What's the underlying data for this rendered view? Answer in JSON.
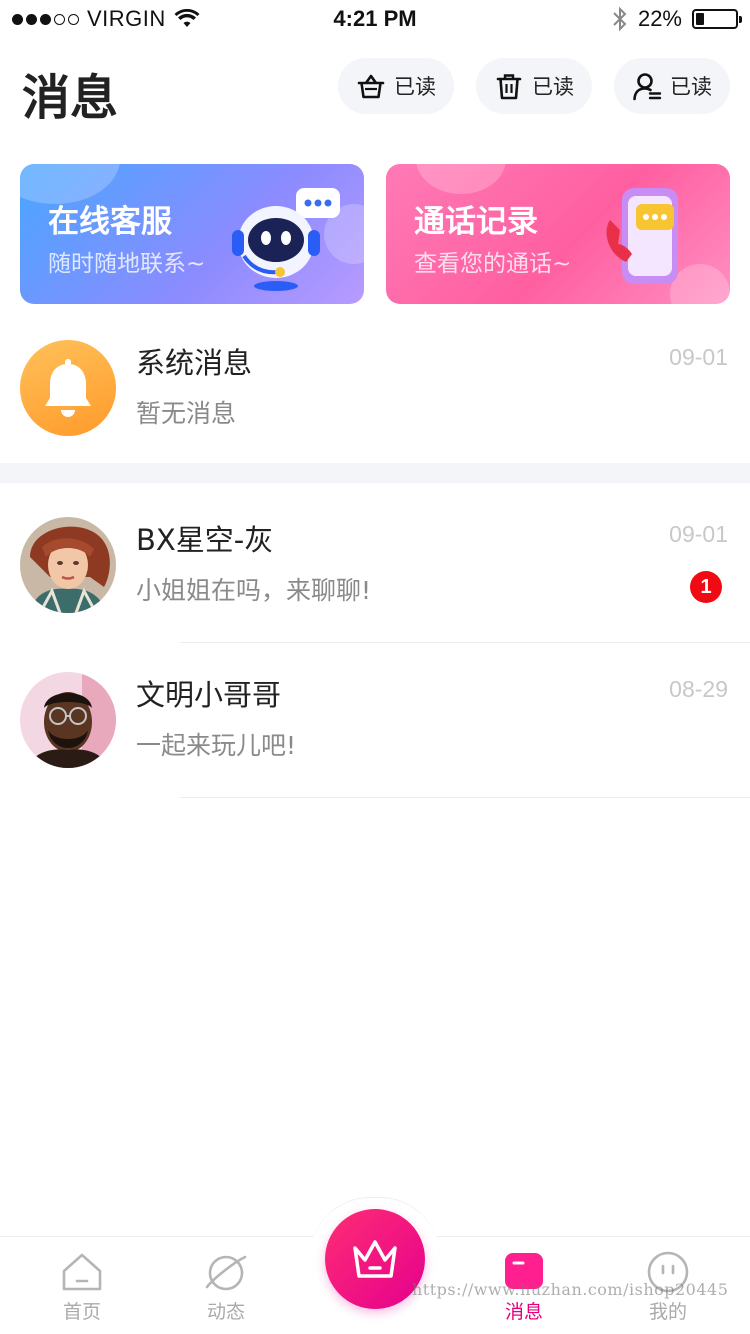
{
  "status_bar": {
    "carrier": "VIRGIN",
    "time": "4:21 PM",
    "battery": "22%",
    "battery_level": 0.22
  },
  "header": {
    "title": "消息",
    "actions": [
      {
        "label": "已读",
        "icon": "basket-icon"
      },
      {
        "label": "已读",
        "icon": "trash-icon"
      },
      {
        "label": "已读",
        "icon": "user-icon"
      }
    ]
  },
  "cards": [
    {
      "title": "在线客服",
      "subtitle": "随时随地联系~",
      "icon": "robot-support-icon"
    },
    {
      "title": "通话记录",
      "subtitle": "查看您的通话~",
      "icon": "phone-call-icon"
    }
  ],
  "system_message": {
    "name": "系统消息",
    "preview": "暂无消息",
    "time": "09-01",
    "icon": "bell-icon"
  },
  "messages": [
    {
      "name": "BX星空-灰",
      "preview": "小姐姐在吗，来聊聊!",
      "time": "09-01",
      "unread": "1"
    },
    {
      "name": "文明小哥哥",
      "preview": "一起来玩儿吧!",
      "time": "08-29",
      "unread": ""
    }
  ],
  "tabbar": {
    "tabs": [
      {
        "label": "首页",
        "icon": "home-icon"
      },
      {
        "label": "动态",
        "icon": "planet-icon"
      },
      {
        "label": "消息",
        "icon": "message-icon",
        "active": true
      },
      {
        "label": "我的",
        "icon": "profile-face-icon"
      }
    ],
    "center_icon": "crown-icon"
  },
  "watermark": "https://www.huzhan.com/ishop20445",
  "colors": {
    "accent": "#e5007f",
    "badge": "#f00a14",
    "card_blue": "#49a6ff",
    "card_pink": "#ff5fa0",
    "bell": "#ffa43a"
  }
}
